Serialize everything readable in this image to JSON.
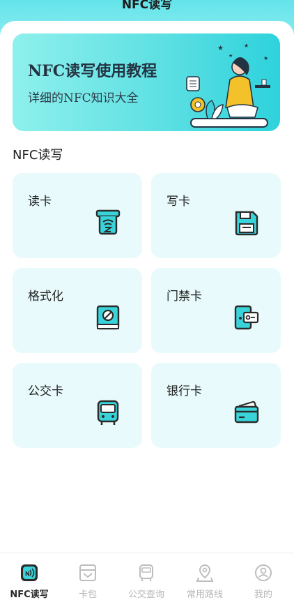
{
  "header": {
    "title": "NFC读写"
  },
  "banner": {
    "title": "NFC读写使用教程",
    "subtitle": "详细的NFC知识大全"
  },
  "section": {
    "title": "NFC读写"
  },
  "cards": [
    {
      "label": "读卡",
      "icon": "read-card-icon"
    },
    {
      "label": "写卡",
      "icon": "save-icon"
    },
    {
      "label": "格式化",
      "icon": "format-icon"
    },
    {
      "label": "门禁卡",
      "icon": "door-card-icon"
    },
    {
      "label": "公交卡",
      "icon": "bus-icon"
    },
    {
      "label": "银行卡",
      "icon": "bank-card-icon"
    }
  ],
  "tabs": [
    {
      "label": "NFC读写",
      "icon": "nfc-icon",
      "active": true
    },
    {
      "label": "卡包",
      "icon": "wallet-icon",
      "active": false
    },
    {
      "label": "公交查询",
      "icon": "bus-icon",
      "active": false
    },
    {
      "label": "常用路线",
      "icon": "location-pin-icon",
      "active": false
    },
    {
      "label": "我的",
      "icon": "user-icon",
      "active": false
    }
  ],
  "colors": {
    "accent": "#3ad7dd",
    "card_bg": "#e8fafb",
    "icon_dark": "#2b2b2b"
  }
}
